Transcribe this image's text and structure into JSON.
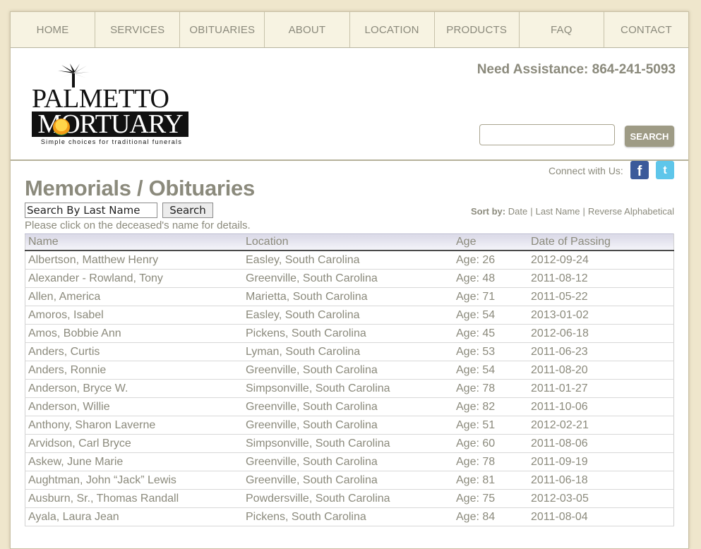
{
  "nav": {
    "items": [
      "HOME",
      "SERVICES",
      "OBITUARIES",
      "ABOUT",
      "LOCATION",
      "PRODUCTS",
      "FAQ",
      "CONTACT"
    ]
  },
  "header": {
    "logo_line1": "PALMETTO",
    "logo_line2": "MORTUARY",
    "logo_tagline": "Simple choices for traditional funerals",
    "assistance": "Need Assistance: 864-241-5093",
    "search_value": "",
    "search_button": "SEARCH",
    "connect_label": "Connect with Us:"
  },
  "main": {
    "title": "Memorials / Obituaries",
    "lastname_search_value": "Search By Last Name",
    "lastname_search_button": "Search",
    "hint": "Please click on the deceased's name for details.",
    "sort_label": "Sort by:",
    "sort_options": [
      "Date",
      "Last Name",
      "Reverse Alphabetical"
    ],
    "columns": [
      "Name",
      "Location",
      "Age",
      "Date of Passing"
    ],
    "rows": [
      {
        "name": "Albertson, Matthew Henry",
        "location": "Easley, South Carolina",
        "age": "Age: 26",
        "date": "2012-09-24"
      },
      {
        "name": "Alexander - Rowland, Tony",
        "location": "Greenville, South Carolina",
        "age": "Age: 48",
        "date": "2011-08-12"
      },
      {
        "name": "Allen, America",
        "location": "Marietta, South Carolina",
        "age": "Age: 71",
        "date": "2011-05-22"
      },
      {
        "name": "Amoros, Isabel",
        "location": "Easley, South Carolina",
        "age": "Age: 54",
        "date": "2013-01-02"
      },
      {
        "name": "Amos, Bobbie Ann",
        "location": "Pickens, South Carolina",
        "age": "Age: 45",
        "date": "2012-06-18"
      },
      {
        "name": "Anders, Curtis",
        "location": "Lyman, South Carolina",
        "age": "Age: 53",
        "date": "2011-06-23"
      },
      {
        "name": "Anders, Ronnie",
        "location": "Greenville, South Carolina",
        "age": "Age: 54",
        "date": "2011-08-20"
      },
      {
        "name": "Anderson, Bryce W.",
        "location": "Simpsonville, South Carolina",
        "age": "Age: 78",
        "date": "2011-01-27"
      },
      {
        "name": "Anderson, Willie",
        "location": "Greenville, South Carolina",
        "age": "Age: 82",
        "date": "2011-10-06"
      },
      {
        "name": "Anthony, Sharon Laverne",
        "location": "Greenville, South Carolina",
        "age": "Age: 51",
        "date": "2012-02-21"
      },
      {
        "name": "Arvidson, Carl Bryce",
        "location": "Simpsonville, South Carolina",
        "age": "Age: 60",
        "date": "2011-08-06"
      },
      {
        "name": "Askew, June Marie",
        "location": "Greenville, South Carolina",
        "age": "Age: 78",
        "date": "2011-09-19"
      },
      {
        "name": "Aughtman, John “Jack” Lewis",
        "location": "Greenville, South Carolina",
        "age": "Age: 81",
        "date": "2011-06-18"
      },
      {
        "name": "Ausburn, Sr., Thomas Randall",
        "location": "Powdersville, South Carolina",
        "age": "Age: 75",
        "date": "2012-03-05"
      },
      {
        "name": "Ayala, Laura Jean",
        "location": "Pickens, South Carolina",
        "age": "Age: 84",
        "date": "2011-08-04"
      }
    ]
  },
  "colors": {
    "page_bg": "#efe6cc",
    "text": "#8b8a7c",
    "nav_bg": "#f7f3e2",
    "button_bg": "#9e9b85",
    "facebook": "#3b5a9a",
    "twitter": "#5ec6ea"
  },
  "icons": [
    "palm-tree-logo-icon",
    "sun-logo-icon",
    "facebook-icon",
    "twitter-icon"
  ]
}
